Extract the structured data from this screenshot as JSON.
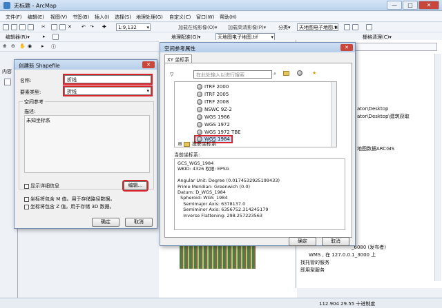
{
  "window": {
    "title": "无标题 - ArcMap",
    "min": "—",
    "max": "□",
    "close": "✕"
  },
  "menu": [
    "文件(F)",
    "编辑(E)",
    "视图(V)",
    "书签(B)",
    "插入(I)",
    "选择(S)",
    "地理处理(G)",
    "自定义(C)",
    "窗口(W)",
    "帮助(H)"
  ],
  "toolbar1": {
    "scale": "1:9,132",
    "georef": "地理配准(G)▾",
    "layer": "天地图电子地图.tif",
    "online": "加载在线影像(O)▾",
    "hires": "加载高清影像(P)▾",
    "fen": "分类▾",
    "mapfile": "天地图电子地图.tif",
    "grid": "栅格清理(C)▾"
  },
  "toolbar2": {
    "editor": "编辑器(R)▾"
  },
  "left_panel": {
    "label": "内容"
  },
  "statusbar": {
    "coords": "112.904  29.55 十进制度"
  },
  "catalog": {
    "lines": [
      "ator\\Desktop",
      "ator\\Desktop\\建筑获取",
      "地图数据ARCGIS",
      "_6080 (发布者)",
      "WMS , 在 127.0.0.1_3000 上",
      "找托管的服务",
      "即用型服务"
    ]
  },
  "shapefile_dialog": {
    "title": "创建新 Shapefile",
    "name_label": "名称:",
    "name_value": "折线",
    "type_label": "要素类型:",
    "type_value": "折线",
    "spatial_ref_label": "空间参考",
    "desc_label": "描述:",
    "desc_value": "未知坐标系",
    "show_details": "显示详细信息",
    "edit_button": "编辑...",
    "m_values": "坐标将包含 M 值。用于存储路径数据。",
    "z_values": "坐标将包含 Z 值。用于存储 3D 数据。",
    "ok": "确定",
    "cancel": "取消"
  },
  "srs_dialog": {
    "title": "空间参考属性",
    "tab": "XY 坐标系",
    "search_placeholder": "在此处输入以进行搜索",
    "list": [
      "ITRF 2000",
      "ITRF 2005",
      "ITRF 2008",
      "NSWC 9Z-2",
      "WGS 1966",
      "WGS 1972",
      "WGS 1972 TBE",
      "WGS 1984"
    ],
    "projected": "投影坐标系",
    "current_label": "当前坐标系:",
    "current_text": "GCS_WGS_1984\nWKID: 4326 权限: EPSG\n\nAngular Unit: Degree (0.0174532925199433)\nPrime Meridian: Greenwich (0.0)\nDatum: D_WGS_1984\n  Spheroid: WGS_1984\n    Semimajor Axis: 6378137.0\n    Semiminor Axis: 6356752.314245179\n    Inverse Flattening: 298.257223563",
    "ok": "确定",
    "cancel": "取消"
  }
}
